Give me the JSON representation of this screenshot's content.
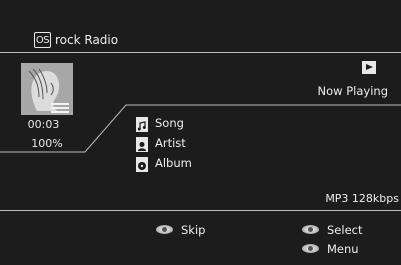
{
  "header": {
    "badge": "OS",
    "title": "rock Radio"
  },
  "player": {
    "status": "Now Playing",
    "time": "00:03",
    "volume": "100%"
  },
  "track": {
    "song_label": "Song",
    "artist_label": "Artist",
    "album_label": "Album"
  },
  "stream": {
    "codec": "MP3 128kbps"
  },
  "footer": {
    "skip_label": "Skip",
    "select_label": "Select",
    "menu_label": "Menu"
  },
  "icons": {
    "source_badge": "os-badge-icon",
    "album_art": "album-art-image",
    "status": "play-icon",
    "song": "music-note-icon",
    "artist": "person-icon",
    "album": "disc-icon",
    "remote": "remote-button-icon"
  }
}
